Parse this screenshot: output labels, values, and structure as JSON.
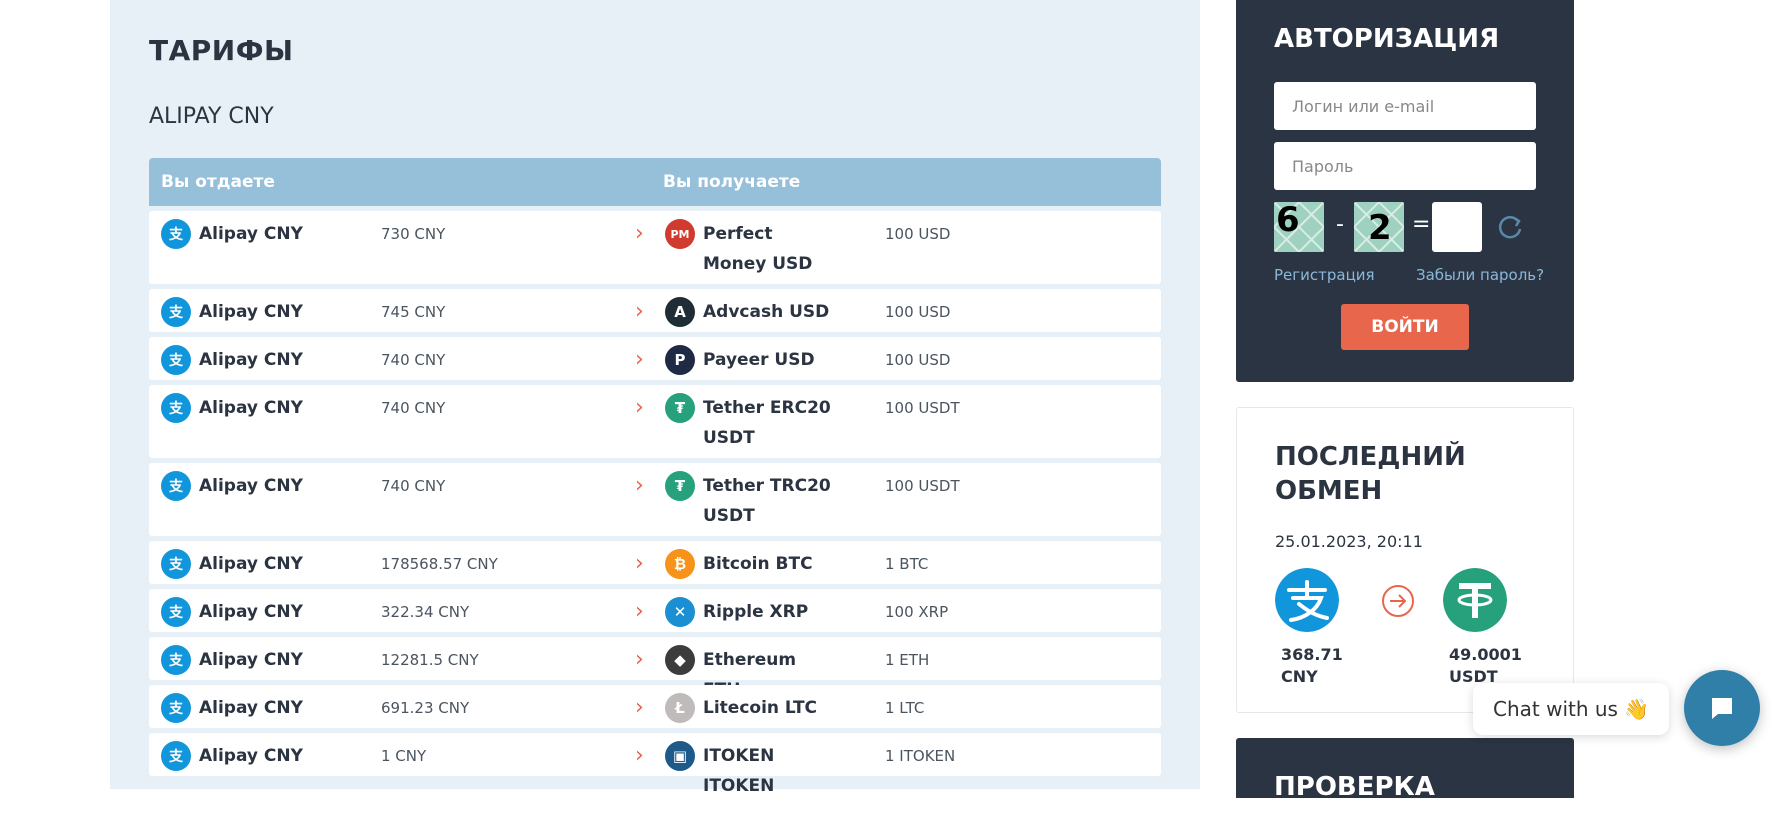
{
  "page": {
    "title": "ТАРИФЫ",
    "subtitle": "ALIPAY CNY"
  },
  "table": {
    "col_give": "Вы отдаете",
    "col_get": "Вы получаете",
    "rows": [
      {
        "give_name": "Alipay CNY",
        "give_amount": "730 CNY",
        "get_name": "Perfect Money USD",
        "get_amount": "100 USD",
        "get_icon": "perfect-money-icon",
        "get_color": "#d13a2f"
      },
      {
        "give_name": "Alipay CNY",
        "give_amount": "745 CNY",
        "get_name": "Advcash USD",
        "get_amount": "100 USD",
        "get_icon": "advcash-icon",
        "get_color": "#1e2d36"
      },
      {
        "give_name": "Alipay CNY",
        "give_amount": "740 CNY",
        "get_name": "Payeer USD",
        "get_amount": "100 USD",
        "get_icon": "payeer-icon",
        "get_color": "#1f2a44"
      },
      {
        "give_name": "Alipay CNY",
        "give_amount": "740 CNY",
        "get_name": "Tether ERC20 USDT",
        "get_amount": "100 USDT",
        "get_icon": "tether-icon",
        "get_color": "#26a17b"
      },
      {
        "give_name": "Alipay CNY",
        "give_amount": "740 CNY",
        "get_name": "Tether TRC20 USDT",
        "get_amount": "100 USDT",
        "get_icon": "tether-icon",
        "get_color": "#26a17b"
      },
      {
        "give_name": "Alipay CNY",
        "give_amount": "178568.57 CNY",
        "get_name": "Bitcoin BTC",
        "get_amount": "1 BTC",
        "get_icon": "bitcoin-icon",
        "get_color": "#f7931a"
      },
      {
        "give_name": "Alipay CNY",
        "give_amount": "322.34 CNY",
        "get_name": "Ripple XRP",
        "get_amount": "100 XRP",
        "get_icon": "ripple-icon",
        "get_color": "#1a8fd1"
      },
      {
        "give_name": "Alipay CNY",
        "give_amount": "12281.5 CNY",
        "get_name": "Ethereum ETH",
        "get_amount": "1 ETH",
        "get_icon": "ethereum-icon",
        "get_color": "#3c3c3d"
      },
      {
        "give_name": "Alipay CNY",
        "give_amount": "691.23 CNY",
        "get_name": "Litecoin LTC",
        "get_amount": "1 LTC",
        "get_icon": "litecoin-icon",
        "get_color": "#bfbbbb"
      },
      {
        "give_name": "Alipay CNY",
        "give_amount": "1 CNY",
        "get_name": "ITOKEN ITOKEN",
        "get_amount": "1 ITOKEN",
        "get_icon": "itoken-icon",
        "get_color": "#1d5a8a"
      }
    ]
  },
  "auth": {
    "title": "АВТОРИЗАЦИЯ",
    "login_placeholder": "Логин или e-mail",
    "password_placeholder": "Пароль",
    "captcha_a": "6",
    "captcha_op": "-",
    "captcha_b": "2",
    "captcha_eq": "=",
    "register_link": "Регистрация",
    "forgot_link": "Забыли пароль?",
    "login_button": "ВОЙТИ"
  },
  "last_exchange": {
    "title_line1": "ПОСЛЕДНИЙ",
    "title_line2": "ОБМЕН",
    "date": "25.01.2023, 20:11",
    "from_amount": "368.71",
    "from_currency": "CNY",
    "to_amount": "49.0001",
    "to_currency": "USDT"
  },
  "status_box": {
    "title": "ПРОВЕРКА СТАТУСА"
  },
  "chat": {
    "label": "Chat with us",
    "emoji": "👋"
  },
  "colors": {
    "accent": "#e8664b",
    "dark": "#2a3442",
    "header": "#96bfd9",
    "alipay": "#1296db",
    "tether": "#26a17b"
  }
}
